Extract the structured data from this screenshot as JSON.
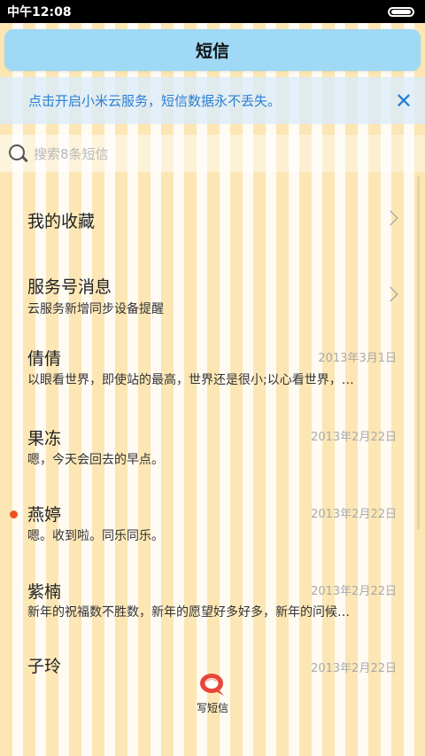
{
  "status_bar": {
    "time": "中午12:08"
  },
  "header": {
    "title": "短信"
  },
  "banner": {
    "text": "点击开启小米云服务，短信数据永不丢失。"
  },
  "search": {
    "placeholder": "搜索8条短信"
  },
  "conversations": [
    {
      "name": "我的收藏",
      "preview": "",
      "date": "",
      "chevron": true
    },
    {
      "name": "服务号消息",
      "preview": "云服务新增同步设备提醒",
      "date": "",
      "chevron": true
    },
    {
      "name": "倩倩",
      "preview": "以眼看世界，即使站的最高，世界还是很小;以心看世界，…",
      "date": "2013年3月1日"
    },
    {
      "name": "果冻",
      "preview": "嗯，今天会回去的早点。",
      "date": "2013年2月22日"
    },
    {
      "name": "燕婷",
      "preview": "嗯。收到啦。同乐同乐。",
      "date": "2013年2月22日",
      "unread": true
    },
    {
      "name": "紫楠",
      "preview": "新年的祝福数不胜数，新年的愿望好多好多，新年的问候…",
      "date": "2013年2月22日"
    },
    {
      "name": "子玲",
      "preview": "",
      "date": "2013年2月22日"
    }
  ],
  "compose": {
    "label": "写短信"
  },
  "colors": {
    "accent_blue": "#2a7fd3",
    "title_bar": "#9fd9f6",
    "unread_dot": "#f0531f",
    "compose_red": "#e8453a"
  }
}
